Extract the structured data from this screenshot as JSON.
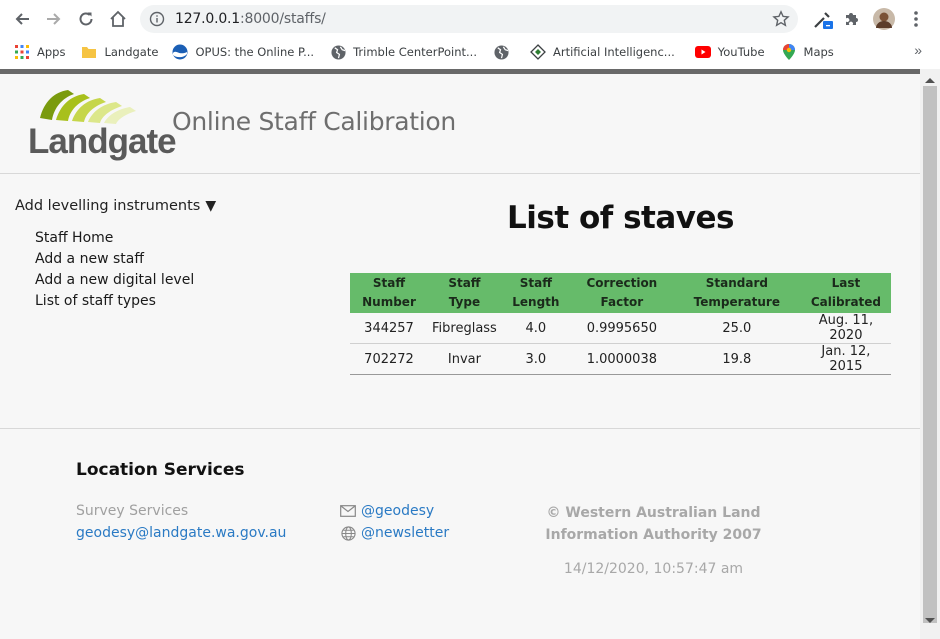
{
  "browser": {
    "url_host": "127.0.0.1",
    "url_path": ":8000/staffs/",
    "bookmarks": [
      {
        "label": "Apps",
        "icon": "apps-grid-icon"
      },
      {
        "label": "Landgate",
        "icon": "folder-icon"
      },
      {
        "label": "OPUS: the Online P...",
        "icon": "noaa-icon"
      },
      {
        "label": "Trimble CenterPoint...",
        "icon": "globe-icon"
      },
      {
        "label": "",
        "icon": "globe-icon"
      },
      {
        "label": "Artificial Intelligenc...",
        "icon": "diamond-icon"
      },
      {
        "label": "YouTube",
        "icon": "youtube-icon"
      },
      {
        "label": "Maps",
        "icon": "maps-pin-icon"
      }
    ],
    "more_label": "»"
  },
  "header": {
    "logo_text": "Landgate",
    "site_title": "Online Staff Calibration"
  },
  "sidebar": {
    "heading": "Add levelling instruments",
    "caret": "▼",
    "links": [
      "Staff Home",
      "Add a new staff",
      "Add a new digital level",
      "List of staff types"
    ]
  },
  "main": {
    "title": "List of staves",
    "table": {
      "headers": [
        [
          "Staff",
          "Number"
        ],
        [
          "Staff Type"
        ],
        [
          "Staff",
          "Length"
        ],
        [
          "Correction",
          "Factor"
        ],
        [
          "Standard",
          "Temperature"
        ],
        [
          "Last",
          "Calibrated"
        ]
      ],
      "rows": [
        [
          "344257",
          "Fibreglass",
          "4.0",
          "0.9995650",
          "25.0",
          "Aug. 11, 2020"
        ],
        [
          "702272",
          "Invar",
          "3.0",
          "1.0000038",
          "19.8",
          "Jan. 12, 2015"
        ]
      ],
      "header_color": "#66bb6a"
    }
  },
  "footer": {
    "title": "Location Services",
    "subtitle": "Survey Services",
    "email": "geodesy@landgate.wa.gov.au",
    "social": [
      {
        "label": "@geodesy",
        "icon": "envelope-icon"
      },
      {
        "label": "@newsletter",
        "icon": "globe-icon"
      }
    ],
    "copyright": "© Western Australian Land Information Authority 2007",
    "timestamp": "14/12/2020, 10:57:47 am",
    "link_color": "#2a7ac4"
  }
}
